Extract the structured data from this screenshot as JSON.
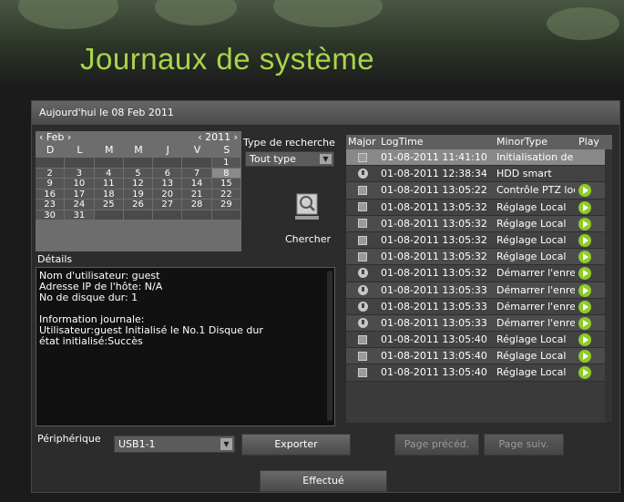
{
  "banner": {
    "title": "Journaux de système"
  },
  "date_bar": {
    "text": "Aujourd'hui le 08 Feb 2011"
  },
  "calendar": {
    "month": "Feb",
    "year": "2011",
    "day_headers": [
      "D",
      "L",
      "M",
      "M",
      "J",
      "V",
      "S"
    ],
    "cells": [
      "",
      "",
      "",
      "",
      "",
      "",
      "1",
      "2",
      "3",
      "4",
      "5",
      "6",
      "7",
      "8",
      "9",
      "10",
      "11",
      "12",
      "13",
      "14",
      "15",
      "16",
      "17",
      "18",
      "19",
      "20",
      "21",
      "22",
      "23",
      "24",
      "25",
      "26",
      "27",
      "28",
      "29",
      "30",
      "31",
      "",
      "",
      "",
      "",
      ""
    ],
    "selected": "8"
  },
  "search": {
    "type_label": "Type de recherche",
    "type_value": "Tout type",
    "button_label": "Chercher"
  },
  "details": {
    "label": "Détails",
    "lines": [
      "Nom d'utilisateur:      guest",
      "Adresse IP de l'hôte: N/A",
      "No de disque dur:     1",
      "",
      "Information journale:",
      "Utilisateur:guest Initialisé le No.1  Disque dur",
      " état initialisé:Succès"
    ]
  },
  "device": {
    "label": "Périphérique",
    "value": "USB1-1"
  },
  "buttons": {
    "export": "Exporter",
    "prev": "Page précéd.",
    "next": "Page suiv.",
    "done": "Effectué"
  },
  "log": {
    "headers": [
      "Major",
      "LogTime",
      "MinorType",
      "Play"
    ],
    "rows": [
      {
        "icon": "doc",
        "time": "01-08-2011 11:41:10",
        "type": "Initialisation de disque",
        "play": false,
        "selected": true
      },
      {
        "icon": "info",
        "time": "01-08-2011 12:38:34",
        "type": "HDD smart",
        "play": false
      },
      {
        "icon": "doc",
        "time": "01-08-2011 13:05:22",
        "type": "Contrôle PTZ local",
        "play": true
      },
      {
        "icon": "doc",
        "time": "01-08-2011 13:05:32",
        "type": "Réglage Local",
        "play": true
      },
      {
        "icon": "doc",
        "time": "01-08-2011 13:05:32",
        "type": "Réglage Local",
        "play": true
      },
      {
        "icon": "doc",
        "time": "01-08-2011 13:05:32",
        "type": "Réglage Local",
        "play": true
      },
      {
        "icon": "doc",
        "time": "01-08-2011 13:05:32",
        "type": "Réglage Local",
        "play": true
      },
      {
        "icon": "info",
        "time": "01-08-2011 13:05:32",
        "type": "Démarrer l'enregistrement",
        "play": true
      },
      {
        "icon": "info",
        "time": "01-08-2011 13:05:33",
        "type": "Démarrer l'enregistrement",
        "play": true
      },
      {
        "icon": "info",
        "time": "01-08-2011 13:05:33",
        "type": "Démarrer l'enregistrement",
        "play": true
      },
      {
        "icon": "info",
        "time": "01-08-2011 13:05:33",
        "type": "Démarrer l'enregistrement",
        "play": true
      },
      {
        "icon": "doc",
        "time": "01-08-2011 13:05:40",
        "type": "Réglage Local",
        "play": true
      },
      {
        "icon": "doc",
        "time": "01-08-2011 13:05:40",
        "type": "Réglage Local",
        "play": true
      },
      {
        "icon": "doc",
        "time": "01-08-2011 13:05:40",
        "type": "Réglage Local",
        "play": true
      }
    ]
  },
  "colors": {
    "accent": "#a8d54b",
    "play": "#8ecb29"
  }
}
